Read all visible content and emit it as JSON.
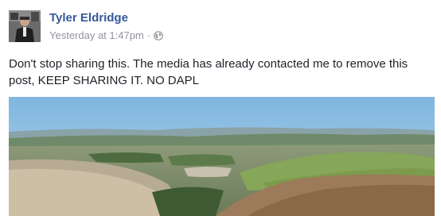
{
  "post": {
    "author_name": "Tyler Eldridge",
    "timestamp": "Yesterday at 1:47pm",
    "separator": "·",
    "privacy_icon": "globe-icon",
    "text": "Don't stop sharing this. The media has already contacted me to remove this post, KEEP SHARING IT. NO DAPL",
    "photo_icon": "landscape-photo"
  },
  "colors": {
    "author": "#365899",
    "meta": "#90949c",
    "text": "#1d2129"
  }
}
